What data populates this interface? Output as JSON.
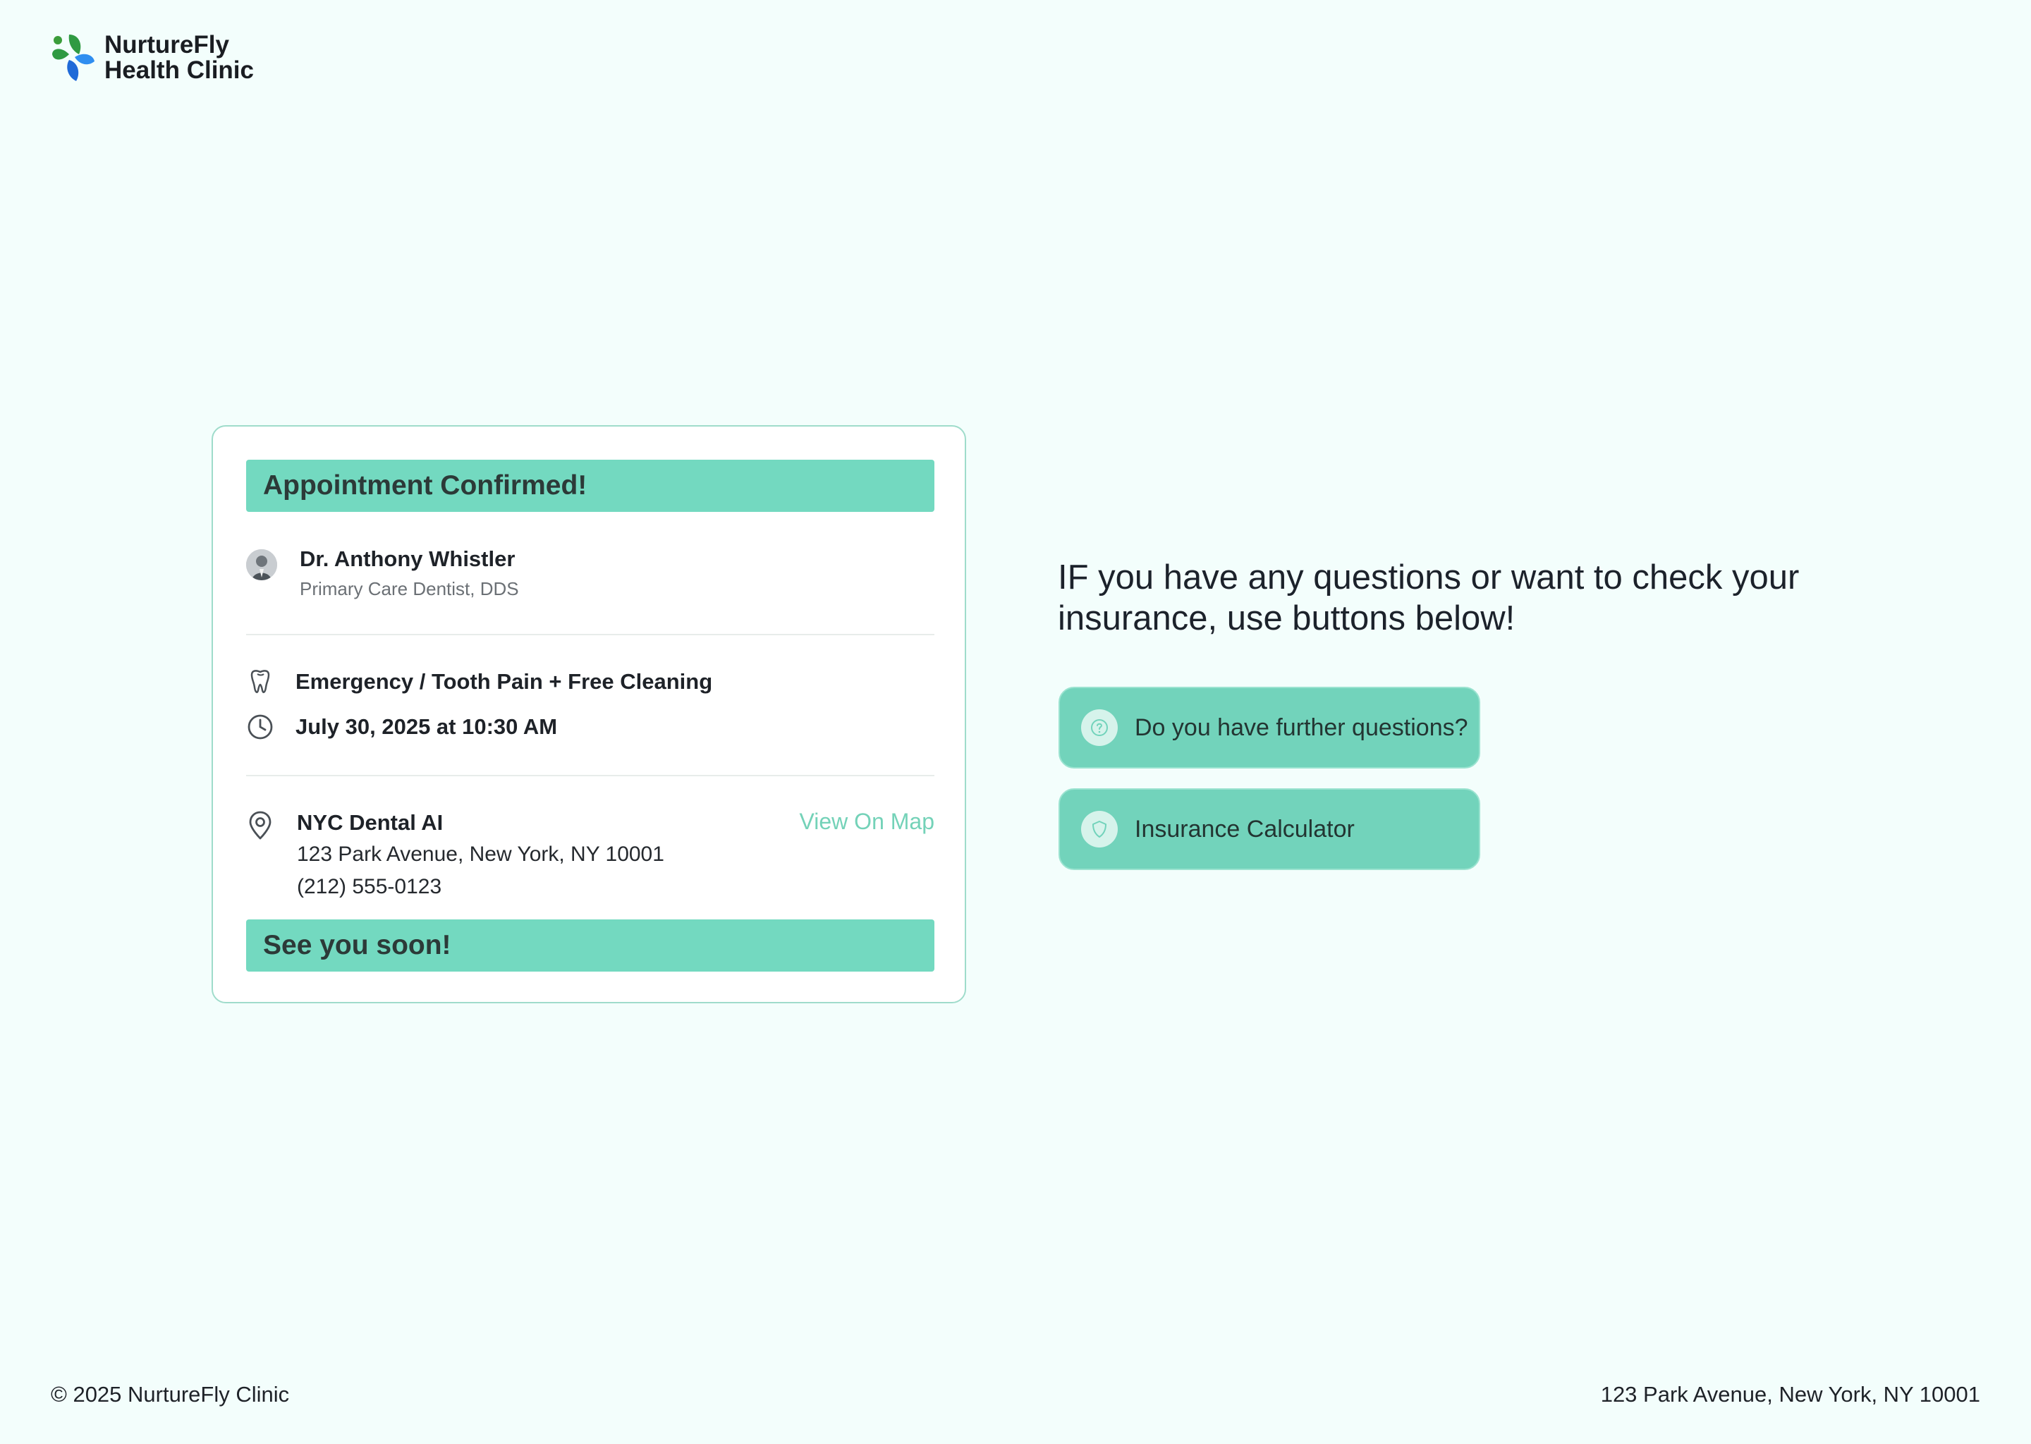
{
  "brand": {
    "name_line1": "NurtureFly",
    "name_line2": "Health Clinic"
  },
  "card": {
    "header": "Appointment Confirmed!",
    "doctor": {
      "name": "Dr. Anthony Whistler",
      "title": "Primary Care Dentist, DDS"
    },
    "service": "Emergency / Tooth Pain + Free Cleaning",
    "datetime": "July 30, 2025 at 10:30 AM",
    "location": {
      "name": "NYC Dental AI",
      "address": "123 Park Avenue, New York, NY 10001",
      "phone": "(212) 555-0123",
      "map_link": "View On Map"
    },
    "footer": "See you soon!"
  },
  "side": {
    "question": "IF you have any questions or want to check your insurance, use buttons below!",
    "buttons": [
      {
        "label": "Do you have further questions?",
        "icon": "question-circle-icon"
      },
      {
        "label": "Insurance Calculator",
        "icon": "shield-icon"
      }
    ]
  },
  "footer": {
    "copyright": "© 2025 NurtureFly Clinic",
    "address": "123 Park Avenue, New York, NY 10001"
  },
  "colors": {
    "background": "#f3fefc",
    "accent": "#73d9c0",
    "link": "#74d2b8",
    "card_border": "#9fdccb"
  }
}
